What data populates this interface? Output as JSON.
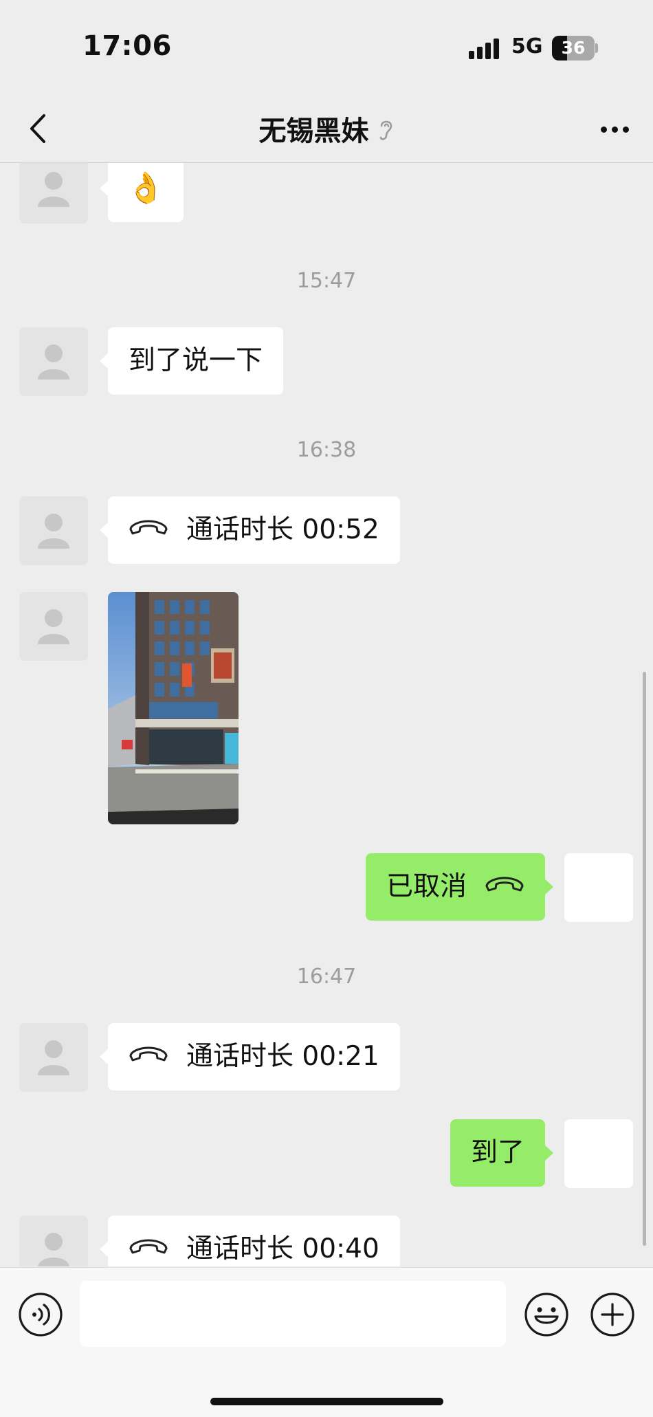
{
  "status_bar": {
    "time": "17:06",
    "network": "5G",
    "battery": "36"
  },
  "header": {
    "title": "无锡黑妹"
  },
  "messages": {
    "emoji": "👌",
    "ts1": "15:47",
    "text1": "到了说一下",
    "ts2": "16:38",
    "call1": "通话时长 00:52",
    "cancelled": "已取消",
    "ts3": "16:47",
    "call2": "通话时长 00:21",
    "arrived": "到了",
    "call3": "通话时长 00:40"
  },
  "input": {
    "placeholder": ""
  },
  "colors": {
    "background": "#ededed",
    "sent_bubble": "#95ec69",
    "received_bubble": "#ffffff"
  },
  "icons": [
    "back-icon",
    "ear-icon",
    "more-icon",
    "phone-icon",
    "voice-icon",
    "emoji-icon",
    "plus-icon"
  ]
}
